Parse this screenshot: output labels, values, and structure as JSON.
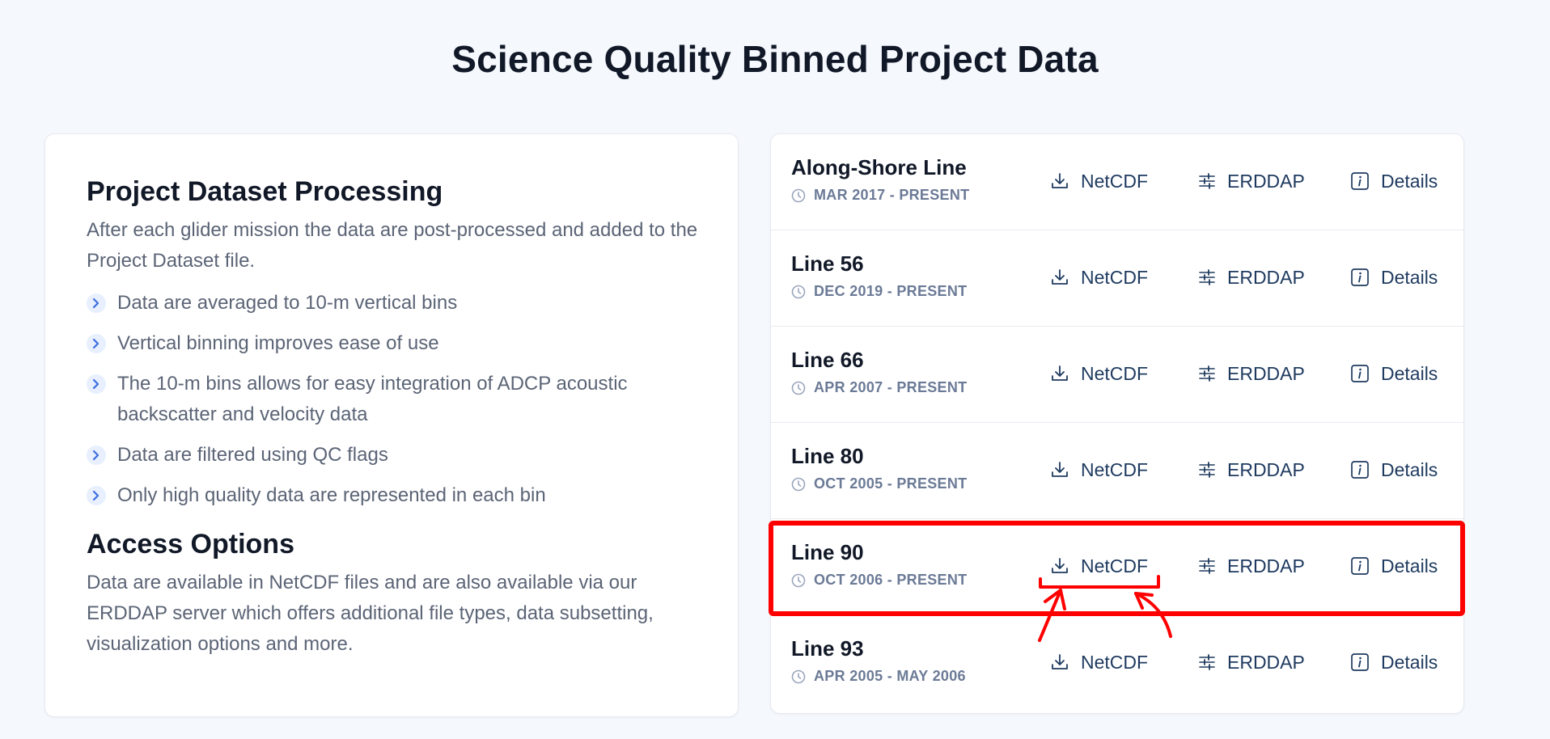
{
  "page": {
    "title": "Science Quality Binned Project Data"
  },
  "processing": {
    "heading": "Project Dataset Processing",
    "intro": "After each glider mission the data are post-processed and added to the Project Dataset file.",
    "bullets": [
      "Data are averaged to 10-m vertical bins",
      "Vertical binning improves ease of use",
      "The 10-m bins allows for easy integration of ADCP acoustic backscatter and velocity data",
      "Data are filtered using QC flags",
      "Only high quality data are represented in each bin"
    ]
  },
  "access": {
    "heading": "Access Options",
    "text": "Data are available in NetCDF files and are also available via our ERDDAP server which offers additional file types, data subsetting, visualization options and more."
  },
  "actions": {
    "netcdf": "NetCDF",
    "erddap": "ERDDAP",
    "details": "Details"
  },
  "datasets": [
    {
      "name": "Along-Shore Line",
      "dates": "MAR 2017 - PRESENT"
    },
    {
      "name": "Line 56",
      "dates": "DEC 2019 - PRESENT"
    },
    {
      "name": "Line 66",
      "dates": "APR 2007 - PRESENT"
    },
    {
      "name": "Line 80",
      "dates": "OCT 2005 - PRESENT"
    },
    {
      "name": "Line 90",
      "dates": "OCT 2006 - PRESENT"
    },
    {
      "name": "Line 93",
      "dates": "APR 2005 - MAY 2006"
    }
  ],
  "icons": {
    "bullet": "chevron-right-icon",
    "date": "clock-icon",
    "netcdf": "download-icon",
    "erddap": "sliders-icon",
    "details": "info-icon"
  },
  "colors": {
    "background": "#f5f8fd",
    "heading": "#111827",
    "body_text": "#5b6476",
    "link": "#1e3a5f",
    "date_text": "#6b7a96",
    "annotation": "#ff0000"
  }
}
